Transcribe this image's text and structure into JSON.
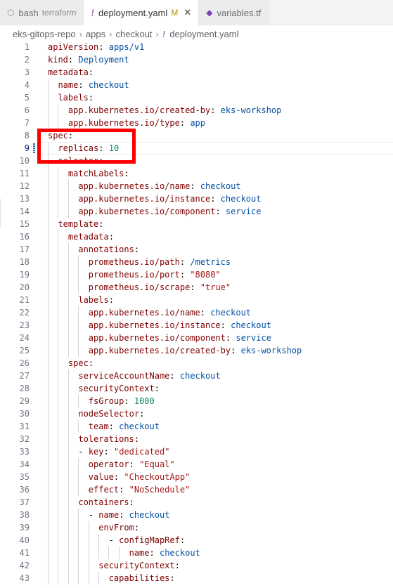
{
  "tabs": [
    {
      "label": "bash",
      "sub": "terraform",
      "icon": "terminal-icon"
    },
    {
      "label": "deployment.yaml",
      "modified": "M",
      "icon": "yaml-file-icon",
      "close": "✕"
    },
    {
      "label": "variables.tf",
      "icon": "terraform-icon"
    }
  ],
  "breadcrumb": [
    "eks-gitops-repo",
    "apps",
    "checkout",
    "deployment.yaml"
  ],
  "editor": {
    "current_line": 9,
    "lines": [
      "apiVersion: apps/v1",
      "kind: Deployment",
      "metadata:",
      "  name: checkout",
      "  labels:",
      "    app.kubernetes.io/created-by: eks-workshop",
      "    app.kubernetes.io/type: app",
      "spec:",
      "  replicas: 10",
      "  selector:",
      "    matchLabels:",
      "      app.kubernetes.io/name: checkout",
      "      app.kubernetes.io/instance: checkout",
      "      app.kubernetes.io/component: service",
      "  template:",
      "    metadata:",
      "      annotations:",
      "        prometheus.io/path: /metrics",
      "        prometheus.io/port: \"8080\"",
      "        prometheus.io/scrape: \"true\"",
      "      labels:",
      "        app.kubernetes.io/name: checkout",
      "        app.kubernetes.io/instance: checkout",
      "        app.kubernetes.io/component: service",
      "        app.kubernetes.io/created-by: eks-workshop",
      "    spec:",
      "      serviceAccountName: checkout",
      "      securityContext:",
      "        fsGroup: 1000",
      "      nodeSelector:",
      "        team: checkout",
      "      tolerations:",
      "      - key: \"dedicated\"",
      "        operator: \"Equal\"",
      "        value: \"CheckoutApp\"",
      "        effect: \"NoSchedule\"",
      "      containers:",
      "        - name: checkout",
      "          envFrom:",
      "            - configMapRef:",
      "                name: checkout",
      "          securityContext:",
      "            capabilities:"
    ]
  },
  "colors": {
    "key": "#800000",
    "string_value": "#0451a5",
    "number_value": "#098658",
    "quoted_value": "#a31515",
    "annotation_box": "#ff0000"
  }
}
